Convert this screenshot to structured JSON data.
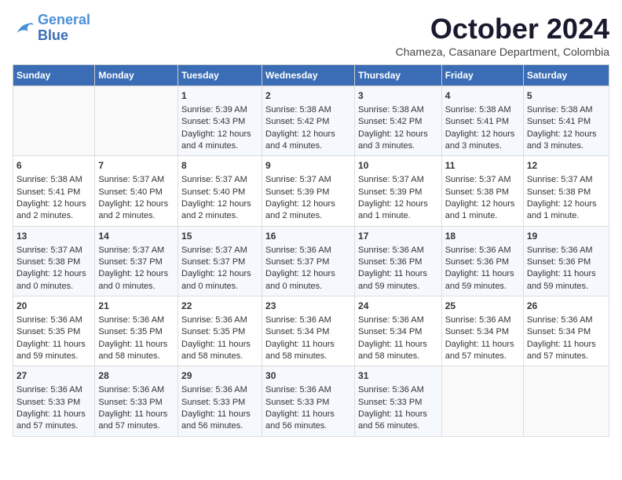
{
  "logo": {
    "line1": "General",
    "line2": "Blue"
  },
  "title": "October 2024",
  "subtitle": "Chameza, Casanare Department, Colombia",
  "columns": [
    "Sunday",
    "Monday",
    "Tuesday",
    "Wednesday",
    "Thursday",
    "Friday",
    "Saturday"
  ],
  "weeks": [
    [
      {
        "day": "",
        "sunrise": "",
        "sunset": "",
        "daylight": ""
      },
      {
        "day": "",
        "sunrise": "",
        "sunset": "",
        "daylight": ""
      },
      {
        "day": "1",
        "sunrise": "Sunrise: 5:39 AM",
        "sunset": "Sunset: 5:43 PM",
        "daylight": "Daylight: 12 hours and 4 minutes."
      },
      {
        "day": "2",
        "sunrise": "Sunrise: 5:38 AM",
        "sunset": "Sunset: 5:42 PM",
        "daylight": "Daylight: 12 hours and 4 minutes."
      },
      {
        "day": "3",
        "sunrise": "Sunrise: 5:38 AM",
        "sunset": "Sunset: 5:42 PM",
        "daylight": "Daylight: 12 hours and 3 minutes."
      },
      {
        "day": "4",
        "sunrise": "Sunrise: 5:38 AM",
        "sunset": "Sunset: 5:41 PM",
        "daylight": "Daylight: 12 hours and 3 minutes."
      },
      {
        "day": "5",
        "sunrise": "Sunrise: 5:38 AM",
        "sunset": "Sunset: 5:41 PM",
        "daylight": "Daylight: 12 hours and 3 minutes."
      }
    ],
    [
      {
        "day": "6",
        "sunrise": "Sunrise: 5:38 AM",
        "sunset": "Sunset: 5:41 PM",
        "daylight": "Daylight: 12 hours and 2 minutes."
      },
      {
        "day": "7",
        "sunrise": "Sunrise: 5:37 AM",
        "sunset": "Sunset: 5:40 PM",
        "daylight": "Daylight: 12 hours and 2 minutes."
      },
      {
        "day": "8",
        "sunrise": "Sunrise: 5:37 AM",
        "sunset": "Sunset: 5:40 PM",
        "daylight": "Daylight: 12 hours and 2 minutes."
      },
      {
        "day": "9",
        "sunrise": "Sunrise: 5:37 AM",
        "sunset": "Sunset: 5:39 PM",
        "daylight": "Daylight: 12 hours and 2 minutes."
      },
      {
        "day": "10",
        "sunrise": "Sunrise: 5:37 AM",
        "sunset": "Sunset: 5:39 PM",
        "daylight": "Daylight: 12 hours and 1 minute."
      },
      {
        "day": "11",
        "sunrise": "Sunrise: 5:37 AM",
        "sunset": "Sunset: 5:38 PM",
        "daylight": "Daylight: 12 hours and 1 minute."
      },
      {
        "day": "12",
        "sunrise": "Sunrise: 5:37 AM",
        "sunset": "Sunset: 5:38 PM",
        "daylight": "Daylight: 12 hours and 1 minute."
      }
    ],
    [
      {
        "day": "13",
        "sunrise": "Sunrise: 5:37 AM",
        "sunset": "Sunset: 5:38 PM",
        "daylight": "Daylight: 12 hours and 0 minutes."
      },
      {
        "day": "14",
        "sunrise": "Sunrise: 5:37 AM",
        "sunset": "Sunset: 5:37 PM",
        "daylight": "Daylight: 12 hours and 0 minutes."
      },
      {
        "day": "15",
        "sunrise": "Sunrise: 5:37 AM",
        "sunset": "Sunset: 5:37 PM",
        "daylight": "Daylight: 12 hours and 0 minutes."
      },
      {
        "day": "16",
        "sunrise": "Sunrise: 5:36 AM",
        "sunset": "Sunset: 5:37 PM",
        "daylight": "Daylight: 12 hours and 0 minutes."
      },
      {
        "day": "17",
        "sunrise": "Sunrise: 5:36 AM",
        "sunset": "Sunset: 5:36 PM",
        "daylight": "Daylight: 11 hours and 59 minutes."
      },
      {
        "day": "18",
        "sunrise": "Sunrise: 5:36 AM",
        "sunset": "Sunset: 5:36 PM",
        "daylight": "Daylight: 11 hours and 59 minutes."
      },
      {
        "day": "19",
        "sunrise": "Sunrise: 5:36 AM",
        "sunset": "Sunset: 5:36 PM",
        "daylight": "Daylight: 11 hours and 59 minutes."
      }
    ],
    [
      {
        "day": "20",
        "sunrise": "Sunrise: 5:36 AM",
        "sunset": "Sunset: 5:35 PM",
        "daylight": "Daylight: 11 hours and 59 minutes."
      },
      {
        "day": "21",
        "sunrise": "Sunrise: 5:36 AM",
        "sunset": "Sunset: 5:35 PM",
        "daylight": "Daylight: 11 hours and 58 minutes."
      },
      {
        "day": "22",
        "sunrise": "Sunrise: 5:36 AM",
        "sunset": "Sunset: 5:35 PM",
        "daylight": "Daylight: 11 hours and 58 minutes."
      },
      {
        "day": "23",
        "sunrise": "Sunrise: 5:36 AM",
        "sunset": "Sunset: 5:34 PM",
        "daylight": "Daylight: 11 hours and 58 minutes."
      },
      {
        "day": "24",
        "sunrise": "Sunrise: 5:36 AM",
        "sunset": "Sunset: 5:34 PM",
        "daylight": "Daylight: 11 hours and 58 minutes."
      },
      {
        "day": "25",
        "sunrise": "Sunrise: 5:36 AM",
        "sunset": "Sunset: 5:34 PM",
        "daylight": "Daylight: 11 hours and 57 minutes."
      },
      {
        "day": "26",
        "sunrise": "Sunrise: 5:36 AM",
        "sunset": "Sunset: 5:34 PM",
        "daylight": "Daylight: 11 hours and 57 minutes."
      }
    ],
    [
      {
        "day": "27",
        "sunrise": "Sunrise: 5:36 AM",
        "sunset": "Sunset: 5:33 PM",
        "daylight": "Daylight: 11 hours and 57 minutes."
      },
      {
        "day": "28",
        "sunrise": "Sunrise: 5:36 AM",
        "sunset": "Sunset: 5:33 PM",
        "daylight": "Daylight: 11 hours and 57 minutes."
      },
      {
        "day": "29",
        "sunrise": "Sunrise: 5:36 AM",
        "sunset": "Sunset: 5:33 PM",
        "daylight": "Daylight: 11 hours and 56 minutes."
      },
      {
        "day": "30",
        "sunrise": "Sunrise: 5:36 AM",
        "sunset": "Sunset: 5:33 PM",
        "daylight": "Daylight: 11 hours and 56 minutes."
      },
      {
        "day": "31",
        "sunrise": "Sunrise: 5:36 AM",
        "sunset": "Sunset: 5:33 PM",
        "daylight": "Daylight: 11 hours and 56 minutes."
      },
      {
        "day": "",
        "sunrise": "",
        "sunset": "",
        "daylight": ""
      },
      {
        "day": "",
        "sunrise": "",
        "sunset": "",
        "daylight": ""
      }
    ]
  ]
}
